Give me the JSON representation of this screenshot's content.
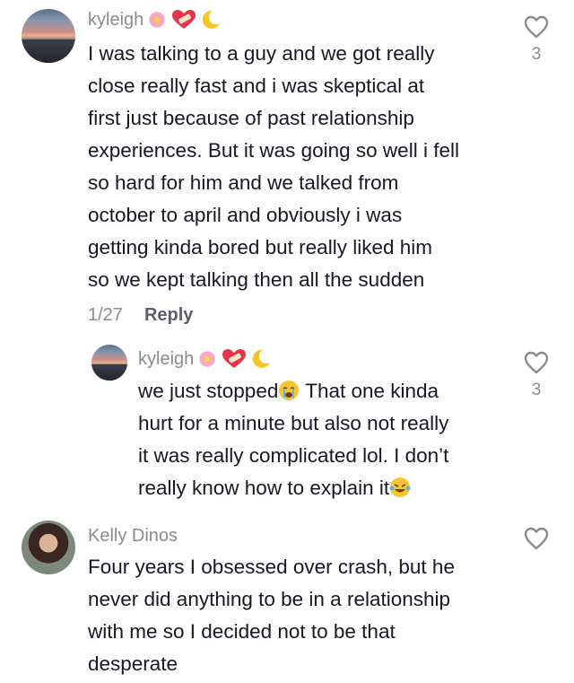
{
  "comments": [
    {
      "username": "kyleigh",
      "text_lines": [
        "I was talking to a guy and we got really",
        "close really fast and i was skeptical at",
        "first just because of past relationship",
        "experiences. But it was going so well i fell",
        "so hard for him and we talked from",
        "october to april and obviously i was",
        "getting kinda bored but really liked him",
        "so we kept talking then all the sudden"
      ],
      "date": "1/27",
      "reply_label": "Reply",
      "like_count": "3",
      "username_emojis": [
        "flower-emoji",
        "heart-bandage-emoji",
        "moon-emoji"
      ]
    },
    {
      "username": "kyleigh",
      "text_lines": [
        "we just stopped",
        " That one kinda",
        "hurt for a minute but also not really",
        "it was really complicated lol. I don’t",
        "really know how to explain it"
      ],
      "like_count": "3",
      "username_emojis": [
        "flower-emoji",
        "heart-bandage-emoji",
        "moon-emoji"
      ]
    },
    {
      "username": "Kelly Dinos",
      "text_lines": [
        "Four years I obsessed over crash, but he",
        "never did anything to be in a relationship",
        "with me so I decided not to be that",
        "desperate"
      ]
    }
  ],
  "colors": {
    "text": "#161823",
    "muted": "#8a8b91",
    "reply": "#5c5e66"
  }
}
